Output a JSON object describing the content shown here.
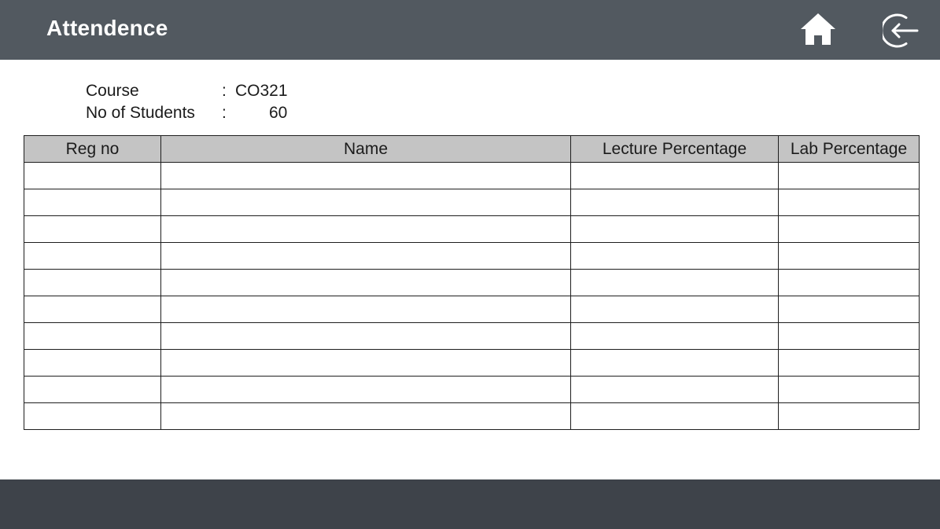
{
  "header": {
    "title": "Attendence",
    "home_icon": "home-icon",
    "logout_icon": "logout-icon",
    "background": "#525960"
  },
  "info": {
    "course_label": "Course",
    "course_value": "CO321",
    "students_label": "No of Students",
    "students_value": "60",
    "separator": ":"
  },
  "table": {
    "columns": [
      "Reg no",
      "Name",
      "Lecture Percentage",
      "Lab Percentage"
    ],
    "rows": [
      [
        "",
        "",
        "",
        ""
      ],
      [
        "",
        "",
        "",
        ""
      ],
      [
        "",
        "",
        "",
        ""
      ],
      [
        "",
        "",
        "",
        ""
      ],
      [
        "",
        "",
        "",
        ""
      ],
      [
        "",
        "",
        "",
        ""
      ],
      [
        "",
        "",
        "",
        ""
      ],
      [
        "",
        "",
        "",
        ""
      ],
      [
        "",
        "",
        "",
        ""
      ],
      [
        "",
        "",
        "",
        ""
      ]
    ],
    "header_background": "#c4c4c4"
  },
  "footer": {
    "background": "#3e434a"
  }
}
